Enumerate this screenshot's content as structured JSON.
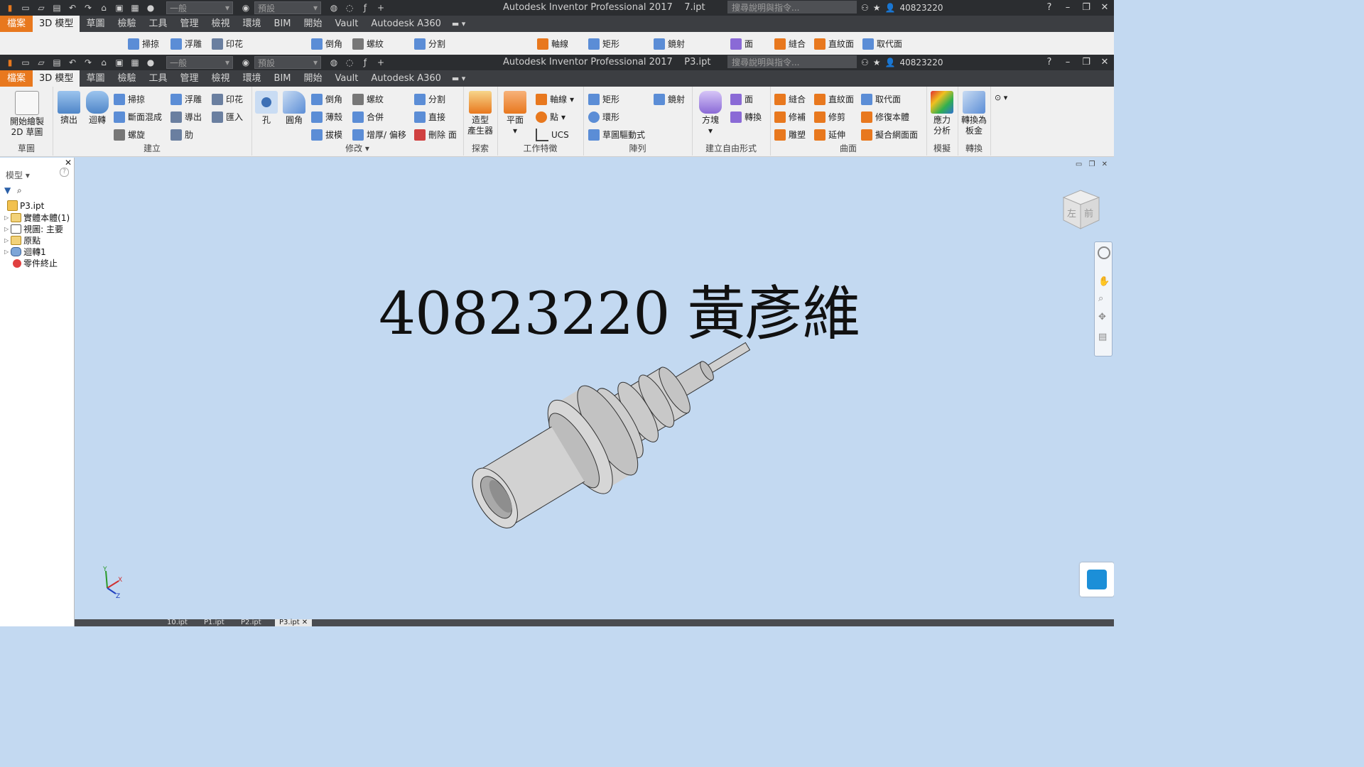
{
  "app": {
    "title_top": "Autodesk Inventor Professional 2017    7.ipt",
    "title_main": "Autodesk Inventor Professional 2017    P3.ipt",
    "search_placeholder": "搜尋說明與指令...",
    "user": "40823220",
    "style_select": "一般",
    "appearance_select": "預設"
  },
  "tabs": [
    "檔案",
    "3D 模型",
    "草圖",
    "檢驗",
    "工具",
    "管理",
    "檢視",
    "環境",
    "BIM",
    "開始",
    "Vault",
    "Autodesk A360"
  ],
  "ribbon": {
    "sketch": {
      "start_sketch": "開始繪製",
      "start_sketch2": "2D 草圖",
      "title": "草圖"
    },
    "create": {
      "extrude": "擠出",
      "revolve": "迴轉",
      "sweep": "掃掠",
      "loft": "斷面混成",
      "coil": "螺旋",
      "emboss": "浮雕",
      "derive": "導出",
      "rib": "肋",
      "decal": "印花",
      "import": "匯入",
      "title": "建立"
    },
    "modify": {
      "hole": "孔",
      "fillet": "圓角",
      "chamfer": "倒角",
      "shell": "薄殼",
      "draft": "拔模",
      "thread": "螺紋",
      "combine": "合併",
      "thicken": "增厚/ 偏移",
      "split": "分割",
      "direct": "直接",
      "delete_face": "刪除 面",
      "title": "修改"
    },
    "explore": {
      "shape_gen": "造型",
      "shape_gen2": "產生器",
      "title": "探索"
    },
    "work": {
      "plane": "平面",
      "axis": "軸線",
      "point": "點",
      "ucs": "UCS",
      "title": "工作特徵"
    },
    "pattern": {
      "rect": "矩形",
      "circ": "環形",
      "sketch_driven": "草圖驅動式",
      "mirror": "鏡射",
      "title": "陣列"
    },
    "freeform": {
      "box": "方塊",
      "face": "面",
      "convert": "轉換",
      "title": "建立自由形式"
    },
    "surface": {
      "stitch": "縫合",
      "patch": "修補",
      "sculpt": "雕塑",
      "ruled": "直紋面",
      "trim": "修剪",
      "extend": "延伸",
      "replace": "取代面",
      "repair": "修復本體",
      "fit_mesh": "擬合網面面",
      "title": "曲面"
    },
    "simulation": {
      "stress": "應力",
      "stress2": "分析",
      "title": "模擬"
    },
    "convert": {
      "sheet": "轉換為",
      "sheet2": "板金",
      "title": "轉換"
    }
  },
  "browser": {
    "title": "模型",
    "items": [
      "P3.ipt",
      "實體本體(1)",
      "視圖: 主要",
      "原點",
      "迴轉1",
      "零件終止"
    ]
  },
  "viewport": {
    "annotation": "40823220 黃彥維",
    "viewcube_left": "左",
    "viewcube_front": "前"
  },
  "doc_tabs": [
    "10.ipt",
    "P1.ipt",
    "P2.ipt",
    "P3.ipt"
  ]
}
